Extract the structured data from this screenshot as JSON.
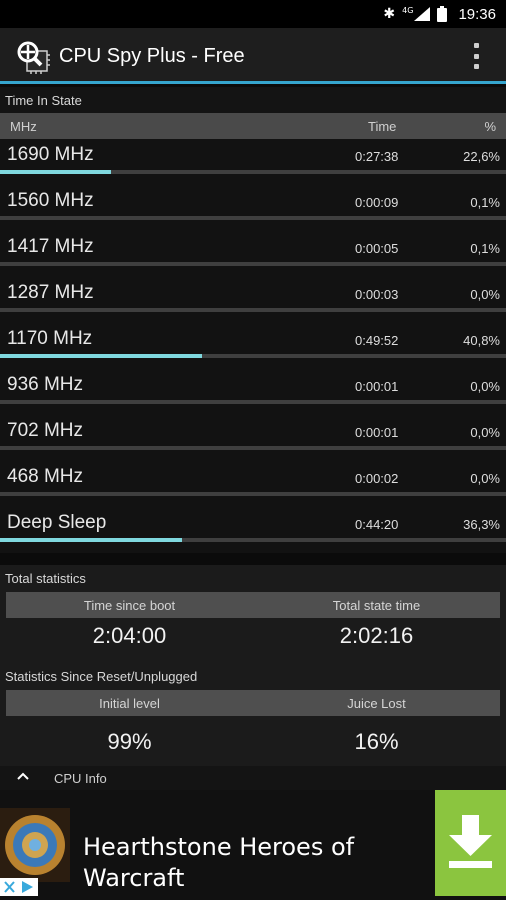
{
  "status_bar": {
    "time": "19:36",
    "network": "4G"
  },
  "app_bar": {
    "title": "CPU Spy Plus - Free"
  },
  "time_in_state": {
    "title": "Time In State",
    "columns": {
      "mhz": "MHz",
      "time": "Time",
      "percent": "%"
    },
    "rows": [
      {
        "freq": "1690 MHz",
        "time": "0:27:38",
        "percent": "22,6%",
        "fraction": 0.22
      },
      {
        "freq": "1560 MHz",
        "time": "0:00:09",
        "percent": "0,1%",
        "fraction": 0.0
      },
      {
        "freq": "1417 MHz",
        "time": "0:00:05",
        "percent": "0,1%",
        "fraction": 0.0
      },
      {
        "freq": "1287 MHz",
        "time": "0:00:03",
        "percent": "0,0%",
        "fraction": 0.0
      },
      {
        "freq": "1170 MHz",
        "time": "0:49:52",
        "percent": "40,8%",
        "fraction": 0.4
      },
      {
        "freq": "936 MHz",
        "time": "0:00:01",
        "percent": "0,0%",
        "fraction": 0.0
      },
      {
        "freq": "702 MHz",
        "time": "0:00:01",
        "percent": "0,0%",
        "fraction": 0.0
      },
      {
        "freq": "468 MHz",
        "time": "0:00:02",
        "percent": "0,0%",
        "fraction": 0.0
      },
      {
        "freq": "Deep Sleep",
        "time": "0:44:20",
        "percent": "36,3%",
        "fraction": 0.36
      }
    ]
  },
  "total_statistics": {
    "title": "Total statistics",
    "left_label": "Time since boot",
    "right_label": "Total state time",
    "left_value": "2:04:00",
    "right_value": "2:02:16"
  },
  "reset_statistics": {
    "title": "Statistics Since Reset/Unplugged",
    "left_label": "Initial level",
    "right_label": "Juice Lost",
    "left_value": "99%",
    "right_value": "16%"
  },
  "cpu_info": {
    "label": "CPU Info"
  },
  "ad": {
    "text": "Hearthstone Heroes of Warcraft"
  },
  "colors": {
    "accent": "#36a6cf",
    "bar_fill": "#7fd8de",
    "ad_green": "#8bc53f"
  }
}
